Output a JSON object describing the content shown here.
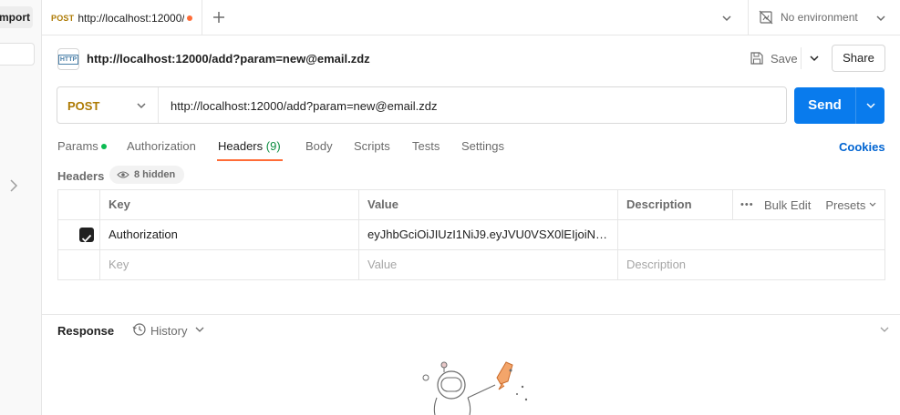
{
  "sidebar": {
    "import_label": "mport"
  },
  "tab": {
    "method": "POST",
    "url": "http://localhost:12000/"
  },
  "environment": {
    "label": "No environment"
  },
  "request": {
    "title": "http://localhost:12000/add?param=new@email.zdz",
    "icon_text": "HTTP",
    "save_label": "Save",
    "share_label": "Share",
    "method": "POST",
    "url": "http://localhost:12000/add?param=new@email.zdz",
    "send_label": "Send"
  },
  "request_tabs": [
    {
      "label": "Params"
    },
    {
      "label": "Authorization"
    },
    {
      "label": "Headers",
      "count": "(9)"
    },
    {
      "label": "Body"
    },
    {
      "label": "Scripts"
    },
    {
      "label": "Tests"
    },
    {
      "label": "Settings"
    }
  ],
  "cookies_label": "Cookies",
  "headers": {
    "label": "Headers",
    "hidden_label": "8 hidden",
    "columns": {
      "key": "Key",
      "value": "Value",
      "description": "Description"
    },
    "bulk_edit": "Bulk Edit",
    "presets": "Presets",
    "rows": [
      {
        "key": "Authorization",
        "value": "eyJhbGciOiJIUzI1NiJ9.eyJVU0VSX0lEIjoiNDM...",
        "description": ""
      }
    ],
    "placeholder": {
      "key": "Key",
      "value": "Value",
      "description": "Description"
    }
  },
  "response": {
    "label": "Response",
    "history_label": "History"
  }
}
